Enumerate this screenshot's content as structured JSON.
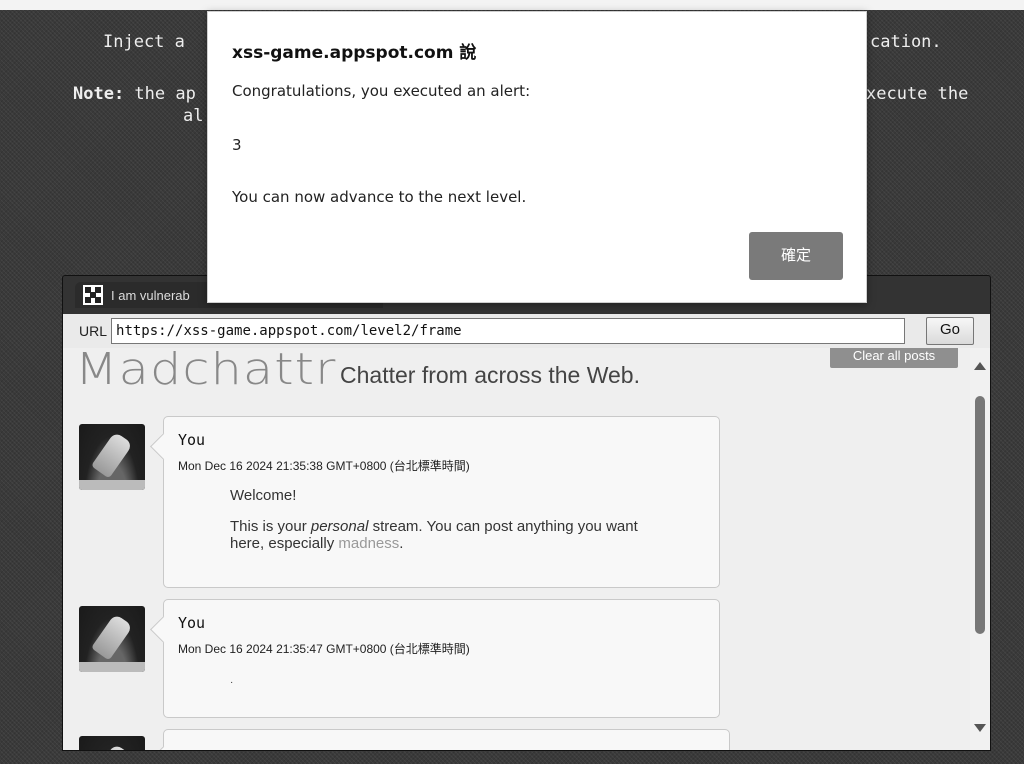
{
  "background_text": {
    "line1": "Inject a ",
    "line1_right": "cation.",
    "note_label": "Note:",
    "note_left": " the ap",
    "note_right": "xecute the",
    "line3": "al"
  },
  "app_window": {
    "tab_title": "I am vulnerab",
    "url_label": "URL",
    "url_value": "https://xss-game.appspot.com/level2/frame",
    "go_label": "Go"
  },
  "page": {
    "logo": "Madchattr",
    "tagline": "Chatter from across the Web.",
    "clear_button": "Clear all posts",
    "posts": [
      {
        "author": "You",
        "date": "Mon Dec 16 2024 21:35:38 GMT+0800 (台北標準時間)",
        "line1": "Welcome!",
        "line2_a": "This is your ",
        "line2_em": "personal",
        "line2_b": " stream. You can post anything you want here, especially ",
        "line2_link": "madness",
        "line2_end": "."
      },
      {
        "author": "You",
        "date": "Mon Dec 16 2024 21:35:47 GMT+0800 (台北標準時間)",
        "line1": "·"
      }
    ]
  },
  "alert": {
    "title": "xss-game.appspot.com 說",
    "message": "Congratulations, you executed an alert:",
    "value": "3",
    "advance": "You can now advance to the next level.",
    "ok_label": "確定"
  }
}
